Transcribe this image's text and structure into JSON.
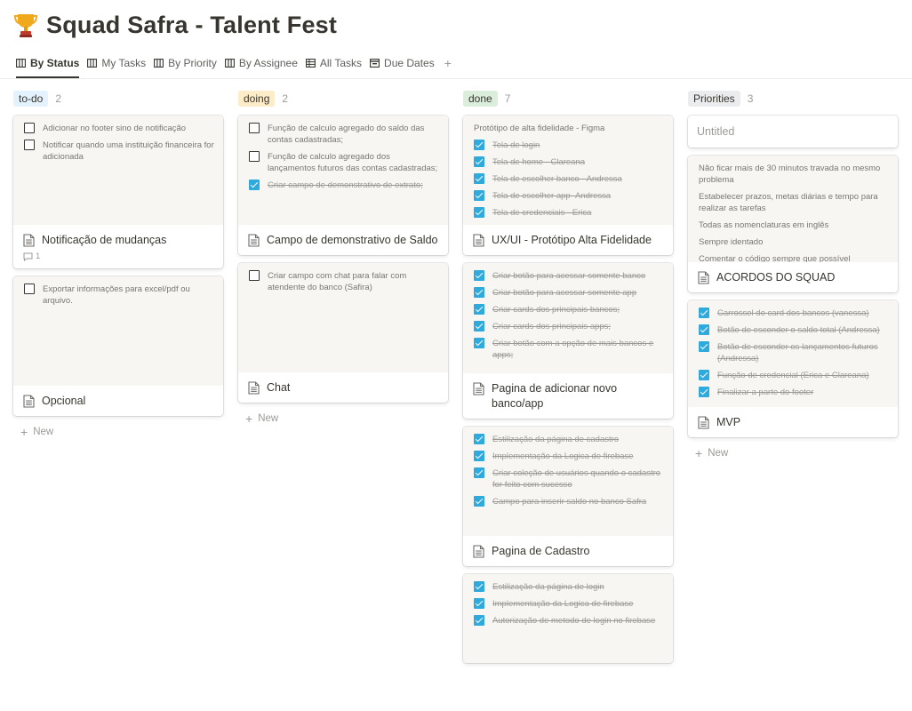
{
  "page": {
    "title": "Squad Safra - Talent Fest",
    "icon": "trophy-icon"
  },
  "views": [
    {
      "label": "By Status",
      "icon": "board-icon",
      "active": true
    },
    {
      "label": "My Tasks",
      "icon": "board-icon"
    },
    {
      "label": "By Priority",
      "icon": "board-icon"
    },
    {
      "label": "By Assignee",
      "icon": "board-icon"
    },
    {
      "label": "All Tasks",
      "icon": "table-icon"
    },
    {
      "label": "Due Dates",
      "icon": "calendar-icon"
    }
  ],
  "add_view_label": "+",
  "new_label": "New",
  "colors": {
    "todo": "#e3f2fd",
    "doing": "#fdecc8",
    "done": "#dbeddb",
    "priorities": "#ebeced",
    "checkbox": "#2eaadc"
  },
  "columns": [
    {
      "name": "to-do",
      "count": "2",
      "cards": [
        {
          "title": "Notificação de mudanças",
          "comments": "1",
          "items": [
            {
              "text": "Adicionar no footer sino de notificação",
              "checked": false
            },
            {
              "text": "Notificar quando uma instituição financeira for adicionada",
              "checked": false
            }
          ]
        },
        {
          "title": "Opcional",
          "items": [
            {
              "text": "Exportar informações para excel/pdf ou arquivo.",
              "checked": false
            }
          ]
        }
      ]
    },
    {
      "name": "doing",
      "count": "2",
      "cards": [
        {
          "title": "Campo de demonstrativo de Saldo",
          "items": [
            {
              "text": "Função de calculo agregado do saldo das contas cadastradas;",
              "checked": false
            },
            {
              "text": "Função de calculo agregado dos lançamentos futuros das contas cadastradas;",
              "checked": false
            },
            {
              "text": "Criar campo de demonstrativo de extrato;",
              "checked": true
            }
          ]
        },
        {
          "title": "Chat",
          "items": [
            {
              "text": "Criar campo com chat  para falar com atendente do banco (Safira)",
              "checked": false
            }
          ]
        }
      ]
    },
    {
      "name": "done",
      "count": "7",
      "cards": [
        {
          "title": "UX/UI - Protótipo Alta Fidelidade",
          "heading": "Protótipo de alta fidelidade - Figma",
          "items": [
            {
              "text": "Tela de login",
              "checked": true
            },
            {
              "text": "Tela de home - Clareana",
              "checked": true
            },
            {
              "text": "Tela de escolher banco - Andressa",
              "checked": true
            },
            {
              "text": "Tela de escolher app- Andressa",
              "checked": true
            },
            {
              "text": "Tela de credenciais - Erica",
              "checked": true
            }
          ]
        },
        {
          "title": "Pagina de adicionar novo banco/app",
          "items": [
            {
              "text": "Criar botão para acessar somente banco",
              "checked": true
            },
            {
              "text": "Criar botão para acessar somente app",
              "checked": true
            },
            {
              "text": "Criar cards dos principais bancos;",
              "checked": true
            },
            {
              "text": "Criar cards dos principais apps;",
              "checked": true
            },
            {
              "text": "Criar botão com a opção de mais bancos e apps;",
              "checked": true
            }
          ]
        },
        {
          "title": "Pagina de Cadastro",
          "items": [
            {
              "text": "Estilização da página de cadastro",
              "checked": true
            },
            {
              "text": "Implementação da Logica de firebase",
              "checked": true
            },
            {
              "text": "Criar coleção de usuários quando o cadastro for feito com sucesso",
              "checked": true
            },
            {
              "text": "Campo para inserir saldo no banco Safra",
              "checked": true
            }
          ]
        },
        {
          "title": "",
          "items": [
            {
              "text": "Estilização da página de login",
              "checked": true
            },
            {
              "text": "Implementação da Logica de firebase",
              "checked": true
            },
            {
              "text": "Autorização de metodo de login no firebase",
              "checked": true
            }
          ]
        }
      ]
    },
    {
      "name": "Priorities",
      "count": "3",
      "cards": [
        {
          "title": "Untitled",
          "untitled": true
        },
        {
          "title": "ACORDOS DO SQUAD",
          "lines": [
            "Não ficar mais de 30 minutos travada no mesmo problema",
            "Estabelecer prazos, metas diárias e tempo para realizar as tarefas",
            "Todas as nomenclaturas em inglês",
            "Sempre identado",
            "Comentar o código sempre que possível"
          ]
        },
        {
          "title": "MVP",
          "items": [
            {
              "text": "Carrossel do card dos bancos (vanessa)",
              "checked": true
            },
            {
              "text": "Botão de esconder o saldo total (Andressa)",
              "checked": true
            },
            {
              "text": "Botão de esconder os lançamentos futuros (Andressa)",
              "checked": true
            },
            {
              "text": "Função de credencial (Erica e Clareana)",
              "checked": true
            },
            {
              "text": "Finalizar a parte do footer",
              "checked": true
            }
          ]
        }
      ]
    }
  ]
}
